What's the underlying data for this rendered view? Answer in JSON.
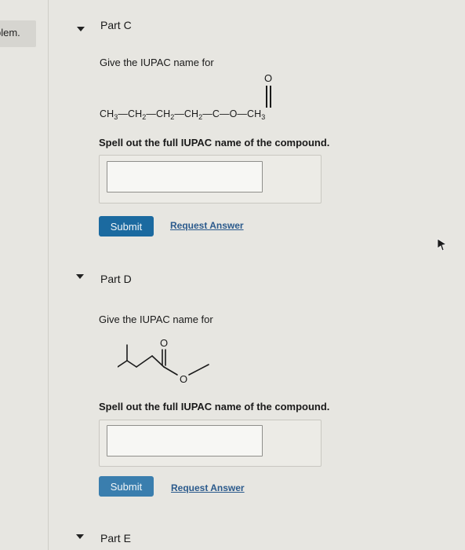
{
  "sidebar": {
    "tab_label": "blem."
  },
  "colors": {
    "accent": "#1b6aa0",
    "link": "#2b5a8c",
    "background": "#e7e6e1"
  },
  "parts": [
    {
      "title": "Part C",
      "prompt": "Give the IUPAC name for",
      "formula": {
        "segments": [
          "CH",
          "3",
          "—CH",
          "2",
          "—CH",
          "2",
          "—CH",
          "2",
          "—C—O—CH",
          "3"
        ],
        "carbonyl_oxygen": "O"
      },
      "instruction": "Spell out the full IUPAC name of the compound.",
      "answer_value": "",
      "submit_label": "Submit",
      "request_label": "Request Answer"
    },
    {
      "title": "Part D",
      "prompt": "Give the IUPAC name for",
      "structure_atoms": {
        "carbonyl_oxygen": "O",
        "ester_oxygen": "O"
      },
      "instruction": "Spell out the full IUPAC name of the compound.",
      "answer_value": "",
      "submit_label": "Submit",
      "request_label": "Request Answer"
    },
    {
      "title": "Part E"
    }
  ],
  "icons": {
    "collapse": "caret-down-icon",
    "cursor": "mouse-pointer-icon"
  }
}
